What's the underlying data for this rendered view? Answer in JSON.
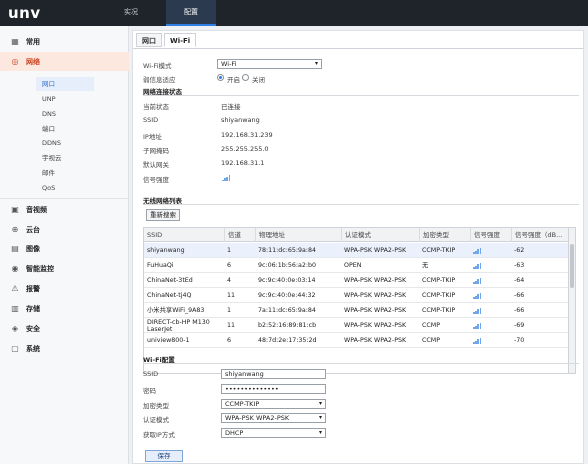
{
  "brand": {
    "logo": "unv"
  },
  "topnav": {
    "preview": "实况",
    "config": "配置"
  },
  "sidebar": {
    "items": [
      {
        "label": "常用",
        "icon": "grid-icon"
      },
      {
        "label": "网络",
        "icon": "globe-icon"
      },
      {
        "label": "音视频",
        "icon": "video-icon"
      },
      {
        "label": "云台",
        "icon": "ptz-icon"
      },
      {
        "label": "图像",
        "icon": "image-icon"
      },
      {
        "label": "智能监控",
        "icon": "smart-icon"
      },
      {
        "label": "报警",
        "icon": "alarm-icon"
      },
      {
        "label": "存储",
        "icon": "storage-icon"
      },
      {
        "label": "安全",
        "icon": "shield-icon"
      },
      {
        "label": "系统",
        "icon": "system-icon"
      }
    ],
    "network_sub": [
      "网口",
      "UNP",
      "DNS",
      "端口",
      "DDNS",
      "宇视云",
      "邮件",
      "QoS"
    ]
  },
  "tabs": [
    "网口",
    "Wi-Fi"
  ],
  "wifi": {
    "mode_label": "Wi-Fi模式",
    "mode_value": "Wi-Fi",
    "weak_label": "弱信息适应",
    "weak_on": "开启",
    "weak_off": "关闭",
    "weak_selected": "on",
    "status_title": "网络连接状态",
    "status": [
      {
        "label": "当前状态",
        "value": "已连接"
      },
      {
        "label": "SSID",
        "value": "shiyanwang"
      },
      {
        "label": "IP地址",
        "value": "192.168.31.239"
      },
      {
        "label": "子网掩码",
        "value": "255.255.255.0"
      },
      {
        "label": "默认网关",
        "value": "192.168.31.1"
      },
      {
        "label": "信号强度",
        "value": ""
      }
    ],
    "status_signal_level": 4,
    "list_title": "无线网络列表",
    "refresh_button": "重新搜索",
    "columns": [
      "SSID",
      "信道",
      "物理地址",
      "认证模式",
      "加密类型",
      "信号强度",
      "信号强度（dB..."
    ],
    "networks": [
      {
        "ssid": "shiyanwang",
        "channel": "1",
        "mac": "78:11:dc:65:9a:84",
        "auth": "WPA-PSK WPA2-PSK",
        "enc": "CCMP-TKIP",
        "signal_level": 4,
        "db": "-62"
      },
      {
        "ssid": "FuHuaQi",
        "channel": "6",
        "mac": "9c:06:1b:56:a2:b0",
        "auth": "OPEN",
        "enc": "无",
        "signal_level": 4,
        "db": "-63"
      },
      {
        "ssid": "ChinaNet-3tEd",
        "channel": "4",
        "mac": "9c:9c:40:0e:03:14",
        "auth": "WPA-PSK WPA2-PSK",
        "enc": "CCMP-TKIP",
        "signal_level": 4,
        "db": "-64"
      },
      {
        "ssid": "ChinaNet-tj4Q",
        "channel": "11",
        "mac": "9c:9c:40:0e:44:32",
        "auth": "WPA-PSK WPA2-PSK",
        "enc": "CCMP-TKIP",
        "signal_level": 4,
        "db": "-66"
      },
      {
        "ssid": "小米共享WiFi_9A83",
        "channel": "1",
        "mac": "7a:11:dc:65:9a:84",
        "auth": "WPA-PSK WPA2-PSK",
        "enc": "CCMP-TKIP",
        "signal_level": 4,
        "db": "-66"
      },
      {
        "ssid": "DIRECT-cb-HP M130 LaserJet",
        "channel": "11",
        "mac": "b2:52:16:89:81:cb",
        "auth": "WPA-PSK WPA2-PSK",
        "enc": "CCMP",
        "signal_level": 4,
        "db": "-69"
      },
      {
        "ssid": "uniview800-1",
        "channel": "6",
        "mac": "48:7d:2e:17:35:2d",
        "auth": "WPA-PSK WPA2-PSK",
        "enc": "CCMP",
        "signal_level": 4,
        "db": "-70"
      }
    ],
    "config_title": "Wi-Fi配置",
    "ssid_label": "SSID",
    "ssid_value": "shiyanwang",
    "password_label": "密码",
    "password_value": "••••••••••••••",
    "enc_label": "加密类型",
    "enc_value": "CCMP-TKIP",
    "auth_label": "认证模式",
    "auth_value": "WPA-PSK WPA2-PSK",
    "ip_label": "获取IP方式",
    "ip_value": "DHCP",
    "save_button": "保存"
  },
  "colors": {
    "accent": "#2f7fe2",
    "active_side": "#c9411e",
    "topbar": "#1f242b"
  }
}
